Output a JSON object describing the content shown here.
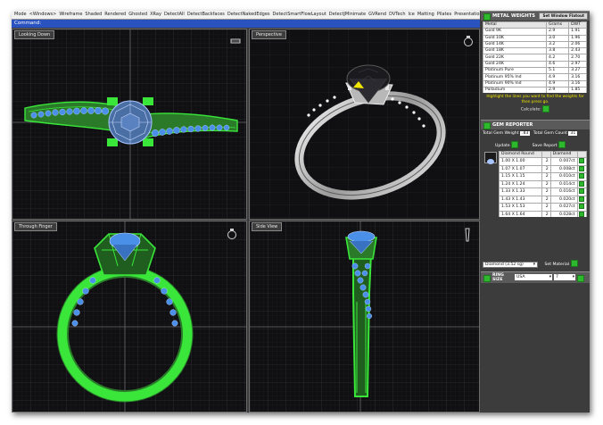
{
  "toolbar": {
    "items": [
      "Mode",
      "<Windows>",
      "Wireframe",
      "Shaded",
      "Rendered",
      "Ghosted",
      "XRay",
      "DetectAll",
      "DetectBackfaces",
      "DetectNakedEdges",
      "DetectSmartFlowLayout",
      "DetectJMinimate",
      "GVRend",
      "DVTech",
      "Ice",
      "Matting",
      "Pilates",
      "Presentation"
    ]
  },
  "command": {
    "label": "Command:"
  },
  "viewports": [
    {
      "label": "Looking Down",
      "icon": "top-view-icon"
    },
    {
      "label": "Perspective",
      "icon": "perspective-icon"
    },
    {
      "label": "Through Finger",
      "icon": "ring-front-icon"
    },
    {
      "label": "Side View",
      "icon": "ring-side-icon"
    }
  ],
  "metal_weights": {
    "title": "METAL WEIGHTS",
    "header_button": "Set Window Flatout",
    "columns": [
      "Metal",
      "Grams",
      "DWT"
    ],
    "rows": [
      [
        "Gold 9K",
        "2.9",
        "1.91"
      ],
      [
        "Gold 10K",
        "3.0",
        "1.96"
      ],
      [
        "Gold 14K",
        "3.2",
        "2.06"
      ],
      [
        "Gold 18K",
        "3.8",
        "2.43"
      ],
      [
        "Gold 22K",
        "4.2",
        "2.70"
      ],
      [
        "Gold 24K",
        "4.6",
        "2.97"
      ],
      [
        "Platinum Pure",
        "5.1",
        "3.27"
      ],
      [
        "Platinum 95% Ind",
        "4.9",
        "3.16"
      ],
      [
        "Platinum 90% Ind",
        "4.9",
        "3.16"
      ],
      [
        "Palladium",
        "2.9",
        "1.85"
      ],
      [
        "Silver Pure",
        "2.5",
        "1.62"
      ],
      [
        "Silver Sterling (92.5%)",
        "2.4",
        "1.60"
      ]
    ],
    "instruction": "Highlight the lines you want to find the weights for then press go.",
    "calculate_label": "Calculate:"
  },
  "gem_reporter": {
    "title": "GEM REPORTER",
    "total_weight_label": "Total Gem Weight",
    "total_weight_value": ".83",
    "total_count_label": "Total Gem Count",
    "total_count_value": "31",
    "update_label": "Update",
    "save_label": "Save Report",
    "columns": [
      "Diamond Round",
      "",
      "Diamond"
    ],
    "rows": [
      [
        "1.00 X 1.00",
        "2",
        "0.007ct"
      ],
      [
        "1.07 X 1.07",
        "2",
        "0.008ct"
      ],
      [
        "1.15 X 1.15",
        "2",
        "0.010ct"
      ],
      [
        "1.24 X 1.24",
        "2",
        "0.014ct"
      ],
      [
        "1.33 X 1.33",
        "2",
        "0.016ct"
      ],
      [
        "1.43 X 1.43",
        "2",
        "0.020ct"
      ],
      [
        "1.53 X 1.53",
        "2",
        "0.027ct"
      ],
      [
        "1.64 X 1.64",
        "2",
        "0.028ct"
      ],
      [
        "1.77 X 1.77",
        "2",
        "0.041ct"
      ],
      [
        "5.26 X 5.26",
        "1",
        "0.53ct"
      ]
    ],
    "material_select": "Diamond (3.52 sg)",
    "set_material_label": "Set Material"
  },
  "ring_size": {
    "title": "RING SIZE",
    "region": "USA",
    "size": "7"
  },
  "colors": {
    "wire_green": "#39e639",
    "wire_blue": "#4a8fe8",
    "panel_header": "#5a5a5a",
    "highlight_yellow": "#f0e600"
  }
}
